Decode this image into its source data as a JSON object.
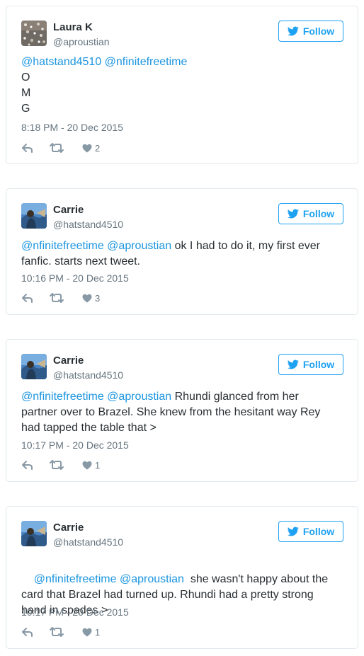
{
  "colors": {
    "accent": "#1da1f2",
    "mention": "#1b95e0",
    "muted": "#66757f",
    "text": "#292f33",
    "border": "#e1e8ed"
  },
  "follow_label": "Follow",
  "icons": {
    "follow": "twitter-bird-icon",
    "reply": "reply-icon",
    "retweet": "retweet-icon",
    "like": "heart-icon"
  },
  "tweets": [
    {
      "name": "Laura K",
      "handle": "@aproustian",
      "avatar": "sparkly-avatar",
      "mentions": "@hatstand4510 @nfinitefreetime",
      "lines": [
        "O",
        "M",
        "G"
      ],
      "timestamp": "8:18 PM - 20 Dec 2015",
      "likes": "2"
    },
    {
      "name": "Carrie",
      "handle": "@hatstand4510",
      "avatar": "blue-avatar",
      "mentions": "@nfinitefreetime @aproustian",
      "text": " ok I had to do it, my first ever fanfic. starts next tweet.",
      "timestamp": "10:16 PM - 20 Dec 2015",
      "likes": "3"
    },
    {
      "name": "Carrie",
      "handle": "@hatstand4510",
      "avatar": "blue-avatar",
      "mentions": "@nfinitefreetime @aproustian",
      "text": " Rhundi glanced from her partner over to Brazel. She knew from the hesitant way Rey had tapped the table that >",
      "timestamp": "10:17 PM - 20 Dec 2015",
      "likes": "1"
    },
    {
      "name": "Carrie",
      "handle": "@hatstand4510",
      "avatar": "blue-avatar",
      "mentions": "@nfinitefreetime @aproustian",
      "text": "  she wasn't happy about the card that Brazel had turned up. Rhundi had a pretty strong hand in spades >",
      "timestamp": "10:17 PM - 20 Dec 2015",
      "likes": "1"
    }
  ]
}
